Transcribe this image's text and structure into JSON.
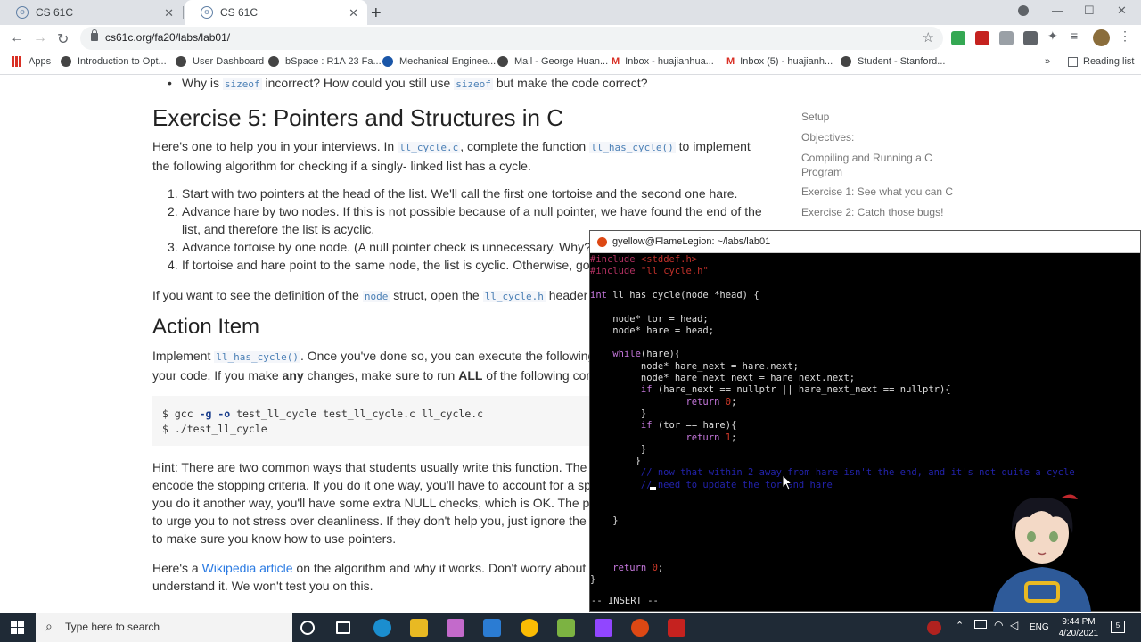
{
  "browser": {
    "tabs": [
      {
        "title": "CS 61C",
        "active": false
      },
      {
        "title": "CS 61C",
        "active": true
      }
    ],
    "url": "cs61c.org/fa20/labs/lab01/",
    "bookmarks": [
      {
        "label": "Apps",
        "icon": "apps-icon"
      },
      {
        "label": "Introduction to Opt...",
        "icon": "globe-icon"
      },
      {
        "label": "User Dashboard",
        "icon": "globe-icon"
      },
      {
        "label": "bSpace : R1A 23 Fa...",
        "icon": "globe-icon"
      },
      {
        "label": "Mechanical Enginee...",
        "icon": "c-logo-icon"
      },
      {
        "label": "Mail - George Huan...",
        "icon": "globe-icon"
      },
      {
        "label": "Inbox - huajianhua...",
        "icon": "gmail-icon"
      },
      {
        "label": "Inbox (5) - huajianh...",
        "icon": "gmail-icon"
      },
      {
        "label": "Student - Stanford...",
        "icon": "globe-icon"
      }
    ],
    "reading_list": "Reading list",
    "more_bookmarks": "»"
  },
  "page": {
    "prev_bullet": {
      "pre": "Why is ",
      "code1": "sizeof",
      "mid": " incorrect? How could you still use ",
      "code2": "sizeof",
      "post": " but make the code correct?"
    },
    "exercise_heading": "Exercise 5: Pointers and Structures in C",
    "intro": {
      "pre": "Here's one to help you in your interviews. In ",
      "code1": "ll_cycle.c",
      "mid": ", complete the function ",
      "code2": "ll_has_cycle()",
      "post": " to implement"
    },
    "intro_line2": "the following algorithm for checking if a singly- linked list has a cycle.",
    "steps": [
      {
        "n": "1.",
        "text": "Start with two pointers at the head of the list. We'll call the first one tortoise and the second one hare."
      },
      {
        "n": "2.",
        "text": "Advance hare by two nodes. If this is not possible because of a null pointer, we have found the end of the"
      },
      {
        "n": "",
        "text": "list, and therefore the list is acyclic."
      },
      {
        "n": "3.",
        "text": "Advance tortoise by one node. (A null pointer check is unnecessary. Why?)"
      },
      {
        "n": "4.",
        "text": "If tortoise and hare point to the same node, the list is cyclic. Otherwise, go"
      }
    ],
    "struct_note": {
      "pre": "If you want to see the definition of the ",
      "code1": "node",
      "mid": " struct, open the ",
      "code2": "ll_cycle.h",
      "post": " header f"
    },
    "action_heading": "Action Item",
    "action": {
      "pre": "Implement ",
      "code1": "ll_has_cycle()",
      "post": ". Once you've done so, you can execute the following"
    },
    "action_line2": {
      "pre": "your code. If you make ",
      "b1": "any",
      "mid": " changes, make sure to run ",
      "b2": "ALL",
      "post": " of the following com"
    },
    "commands": [
      {
        "prompt": "$ ",
        "text1": "gcc ",
        "flag1": "-g",
        "text2": " ",
        "flag2": "-o",
        "text3": " test_ll_cycle test_ll_cycle.c ll_cycle.c"
      },
      {
        "prompt": "$ ",
        "text1": "./test_ll_cycle",
        "flag1": "",
        "text2": "",
        "flag2": "",
        "text3": ""
      }
    ],
    "hint_lines": [
      "Hint: There are two common ways that students usually write this function. The",
      "encode the stopping criteria. If you do it one way, you'll have to account for a sp",
      "you do it another way, you'll have some extra NULL checks, which is OK. The pre",
      "to urge you to not stress over cleanliness. If they don't help you, just ignore the",
      "to make sure you know how to use pointers."
    ],
    "wiki": {
      "pre": "Here's a ",
      "link": "Wikipedia article",
      "post": " on the algorithm and why it works. Don't worry about"
    },
    "wiki_line2": "understand it. We won't test you on this.",
    "sidebar": [
      "Setup",
      "Objectives:",
      "Compiling and Running a C",
      "Program",
      "Exercise 1: See what you can C",
      "Exercise 2: Catch those bugs!"
    ]
  },
  "terminal": {
    "title": "gyellow@FlameLegion: ~/labs/lab01",
    "lines": [
      {
        "parts": [
          {
            "t": "#include ",
            "c": "pp"
          },
          {
            "t": "<stddef.h>",
            "c": "str"
          }
        ]
      },
      {
        "parts": [
          {
            "t": "#include ",
            "c": "pp"
          },
          {
            "t": "\"ll_cycle.h\"",
            "c": "str"
          }
        ]
      },
      {
        "parts": [
          {
            "t": "",
            "c": ""
          }
        ]
      },
      {
        "parts": [
          {
            "t": "int",
            "c": "kw"
          },
          {
            "t": " ll_has_cycle(node *head) {",
            "c": ""
          }
        ]
      },
      {
        "parts": [
          {
            "t": "",
            "c": ""
          }
        ]
      },
      {
        "parts": [
          {
            "t": "    node* tor = head;",
            "c": ""
          }
        ]
      },
      {
        "parts": [
          {
            "t": "    node* hare = head;",
            "c": ""
          }
        ]
      },
      {
        "parts": [
          {
            "t": "",
            "c": ""
          }
        ]
      },
      {
        "parts": [
          {
            "t": "    ",
            "c": ""
          },
          {
            "t": "while",
            "c": "kw"
          },
          {
            "t": "(hare){",
            "c": ""
          }
        ]
      },
      {
        "parts": [
          {
            "t": "         node* hare_next = hare.next;",
            "c": ""
          }
        ]
      },
      {
        "parts": [
          {
            "t": "         node* hare_next_next = hare_next.next;",
            "c": ""
          }
        ]
      },
      {
        "parts": [
          {
            "t": "         ",
            "c": ""
          },
          {
            "t": "if",
            "c": "kw"
          },
          {
            "t": " (hare_next == nullptr || hare_next_next == nullptr){",
            "c": ""
          }
        ]
      },
      {
        "parts": [
          {
            "t": "                 ",
            "c": ""
          },
          {
            "t": "return",
            "c": "kw"
          },
          {
            "t": " ",
            "c": ""
          },
          {
            "t": "0",
            "c": "num-lit"
          },
          {
            "t": ";",
            "c": ""
          }
        ]
      },
      {
        "parts": [
          {
            "t": "         }",
            "c": ""
          }
        ]
      },
      {
        "parts": [
          {
            "t": "         ",
            "c": ""
          },
          {
            "t": "if",
            "c": "kw"
          },
          {
            "t": " (tor == hare){",
            "c": ""
          }
        ]
      },
      {
        "parts": [
          {
            "t": "                 ",
            "c": ""
          },
          {
            "t": "return",
            "c": "kw"
          },
          {
            "t": " ",
            "c": ""
          },
          {
            "t": "1",
            "c": "num-lit"
          },
          {
            "t": ";",
            "c": ""
          }
        ]
      },
      {
        "parts": [
          {
            "t": "         }",
            "c": ""
          }
        ]
      },
      {
        "parts": [
          {
            "t": "        }",
            "c": ""
          }
        ]
      },
      {
        "parts": [
          {
            "t": "         // now that within 2 away from hare isn't the end, and it's not quite a cycle",
            "c": "cmt"
          }
        ]
      },
      {
        "parts": [
          {
            "t": "         // need to update the tor and hare",
            "c": "cmt"
          }
        ]
      },
      {
        "parts": [
          {
            "t": "",
            "c": ""
          }
        ]
      },
      {
        "parts": [
          {
            "t": "",
            "c": ""
          }
        ]
      },
      {
        "parts": [
          {
            "t": "    }",
            "c": ""
          }
        ]
      },
      {
        "parts": [
          {
            "t": "",
            "c": ""
          }
        ]
      },
      {
        "parts": [
          {
            "t": "",
            "c": ""
          }
        ]
      },
      {
        "parts": [
          {
            "t": "",
            "c": ""
          }
        ]
      },
      {
        "parts": [
          {
            "t": "    ",
            "c": ""
          },
          {
            "t": "return",
            "c": "kw"
          },
          {
            "t": " ",
            "c": ""
          },
          {
            "t": "0",
            "c": "num-lit"
          },
          {
            "t": ";",
            "c": ""
          }
        ]
      },
      {
        "parts": [
          {
            "t": "}",
            "c": ""
          }
        ]
      }
    ],
    "mode": "-- INSERT --"
  },
  "taskbar": {
    "search_placeholder": "Type here to search",
    "lang": "ENG",
    "time": "9:44 PM",
    "date": "4/20/2021",
    "notif_count": "5"
  }
}
